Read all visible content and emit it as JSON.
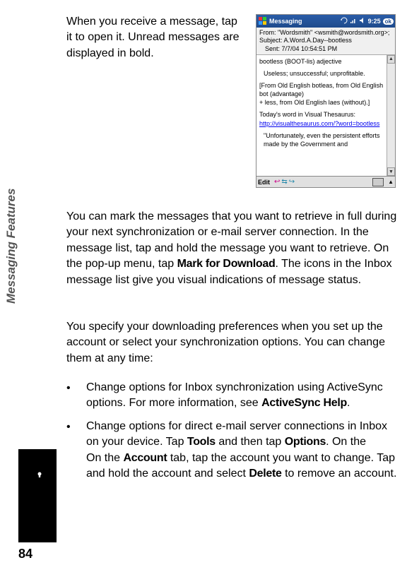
{
  "top_text": "When you receive a message, tap it to open it. Unread messages are displayed in bold.",
  "screenshot": {
    "titlebar": {
      "title": "Messaging",
      "time": "9:25",
      "ok": "ok"
    },
    "header": {
      "from_label": "From:",
      "from_value": "\"Wordsmith\" <wsmith@wordsmith.org>;",
      "subject_label": "Subject:",
      "subject_value": "A.Word.A.Day--bootless",
      "sent_label": "Sent:",
      "sent_value": "7/7/04 10:54:51 PM"
    },
    "body": {
      "l1": "bootless (BOOT-lis) adjective",
      "l2": "Useless; unsuccessful; unprofitable.",
      "l3": "[From Old English botleas, from Old English bot (advantage)",
      "l4": "+ less, from Old English laes (without).]",
      "l5": "Today's word in Visual Thesaurus:",
      "link": "http://visualthesaurus.com/?word=bootless",
      "l6": "\"Unfortunately, even the persistent efforts made by the Government and"
    },
    "bottombar": {
      "edit": "Edit"
    }
  },
  "para2_pre": "You can mark the messages that you want to retrieve in full during your next synchronization or e-mail server connection. In the message list, tap and hold the message you want to retrieve. On the pop-up menu, tap ",
  "para2_bold": "Mark for Download",
  "para2_post": ". The icons in the Inbox message list give you visual indications of message status.",
  "para3": "You specify your downloading preferences when you set up the account or select your synchronization options. You can change them at any time:",
  "bullet1_pre": "Change options for Inbox synchronization using ActiveSync options. For more information, see ",
  "bullet1_bold": "ActiveSync Help",
  "bullet1_post": ".",
  "bullet2_pre": "Change options for direct e-mail server connections in Inbox on your device. Tap ",
  "bullet2_b1": "Tools",
  "bullet2_mid1": " and then tap ",
  "bullet2_b2": "Options",
  "bullet2_mid2": ". On the ",
  "bullet2_b3": "Account",
  "bullet2_mid3": " tab, tap the account you want to change. Tap and hold the account and select ",
  "bullet2_b4": "Delete",
  "bullet2_post": " to remove an account.",
  "side_tab": "Messaging Features",
  "page_num": "84",
  "bullet_marker": "•"
}
